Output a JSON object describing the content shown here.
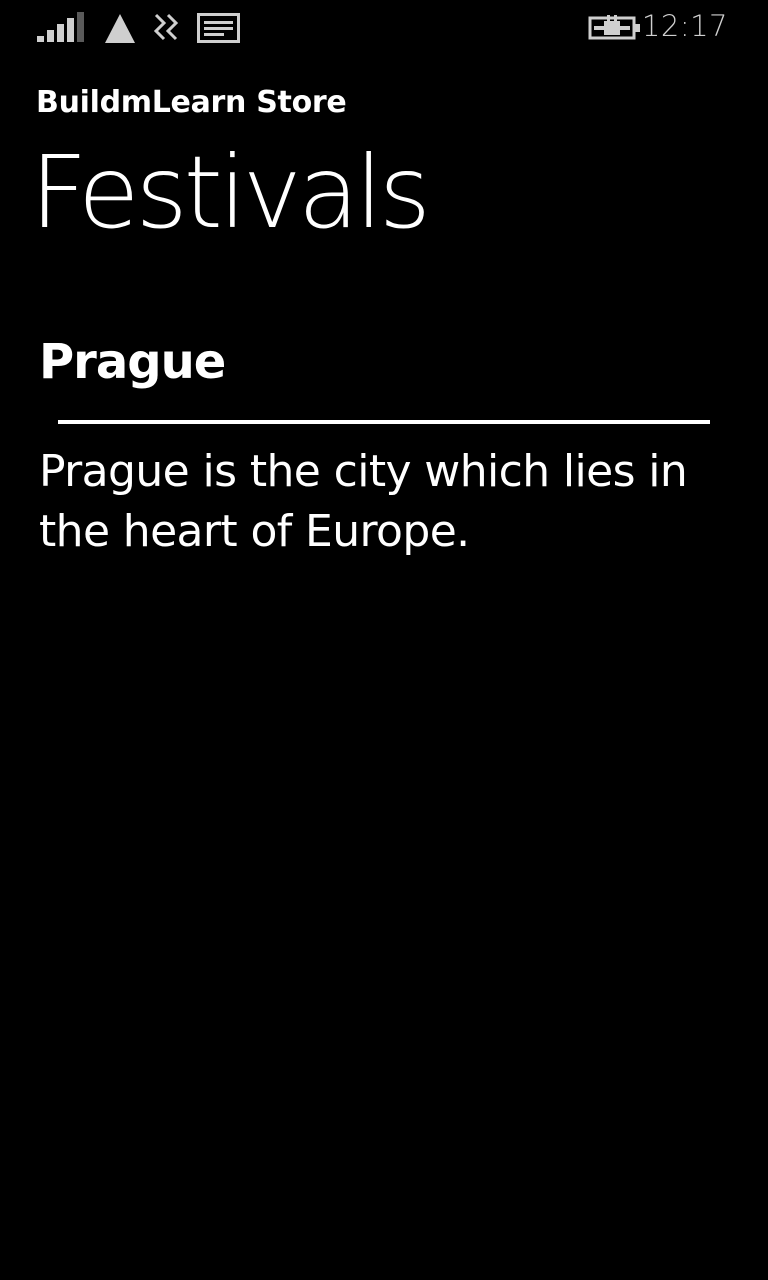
{
  "status_bar": {
    "time": "12:17",
    "icons": [
      "signal-bars-icon",
      "data-connection-icon",
      "vibrate-icon",
      "notification-message-icon",
      "battery-charging-icon"
    ]
  },
  "header": {
    "app_title": "BuildmLearn Store",
    "page_title": "Festivals"
  },
  "detail": {
    "heading": "Prague",
    "description": "Prague is the city which lies in the heart of Europe."
  }
}
